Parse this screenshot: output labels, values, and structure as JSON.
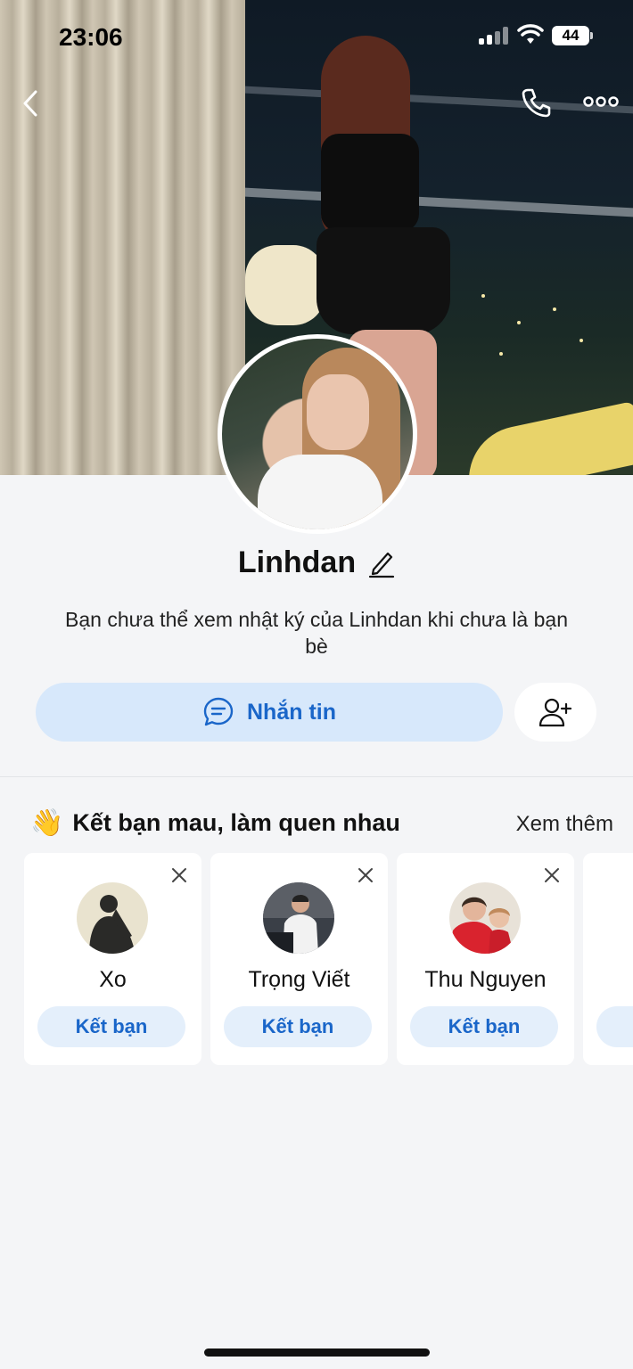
{
  "status_bar": {
    "time": "23:06",
    "battery": "44"
  },
  "profile": {
    "name": "Linhdan",
    "privacy_note": "Bạn chưa thể xem nhật ký của Linhdan khi chưa là bạn bè",
    "message_label": "Nhắn tin"
  },
  "suggestions": {
    "title": "Kết bạn mau, làm quen nhau",
    "title_emoji": "👋",
    "see_more": "Xem thêm",
    "add_label": "Kết bạn",
    "people": [
      {
        "name": "Xo"
      },
      {
        "name": "Trọng Viết"
      },
      {
        "name": "Thu Nguyen"
      }
    ]
  },
  "colors": {
    "accent": "#1a66c9",
    "accent_bg": "#d7e8fb",
    "page_bg": "#f4f5f7"
  },
  "icons": {
    "back": "chevron-left-icon",
    "call": "phone-icon",
    "more": "more-dots-icon",
    "edit": "pencil-icon",
    "message": "chat-bubble-icon",
    "add_friend": "add-user-icon",
    "dismiss": "close-icon"
  }
}
